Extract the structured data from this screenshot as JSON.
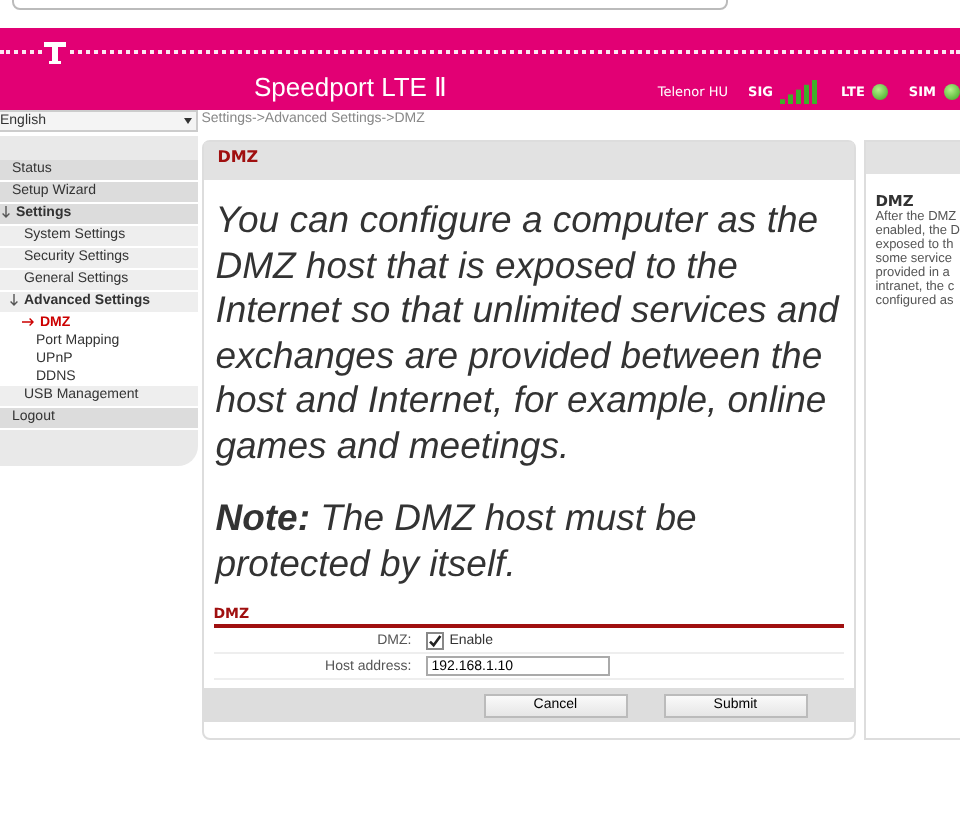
{
  "header": {
    "product": "Speedport LTE Ⅱ",
    "operator": "Telenor HU",
    "sig_label": "SIG",
    "lte_label": "LTE",
    "sim_label": "SIM"
  },
  "sidebar": {
    "language": "English",
    "items": [
      {
        "label": "Status",
        "selected": false
      },
      {
        "label": "Setup Wizard",
        "selected": false
      },
      {
        "label": "Settings",
        "selected": false,
        "expanded": true,
        "children": [
          {
            "label": "System Settings",
            "selected": false
          },
          {
            "label": "Security Settings",
            "selected": false
          },
          {
            "label": "General Settings",
            "selected": false
          },
          {
            "label": "Advanced Settings",
            "selected": false,
            "expanded": true,
            "children": [
              {
                "label": "DMZ",
                "selected": true
              },
              {
                "label": "Port Mapping",
                "selected": false
              },
              {
                "label": "UPnP",
                "selected": false
              },
              {
                "label": "DDNS",
                "selected": false
              }
            ]
          },
          {
            "label": "USB Management",
            "selected": false
          }
        ]
      },
      {
        "label": "Logout",
        "selected": false
      }
    ]
  },
  "breadcrumb": "Settings->Advanced Settings->DMZ",
  "panel": {
    "title": "DMZ",
    "intro": "You can configure a computer as the DMZ host that is exposed to the Internet so that unlimited services and exchanges are provided between the host and Internet, for example, online games and meetings.",
    "note": "**Note:** The DMZ host must be protected by itself.",
    "section": "DMZ",
    "dmz_label": "DMZ:",
    "enable_label": "Enable",
    "enabled": true,
    "host_label": "Host address:",
    "host_value": "192.168.1.10",
    "buttons": [
      "Cancel",
      "Submit"
    ]
  },
  "help": {
    "title": "DMZ",
    "lines": [
      "After the DMZ",
      "enabled, the D",
      "exposed to th",
      "some service",
      "provided in a",
      "intranet, the c",
      "configured as"
    ]
  }
}
